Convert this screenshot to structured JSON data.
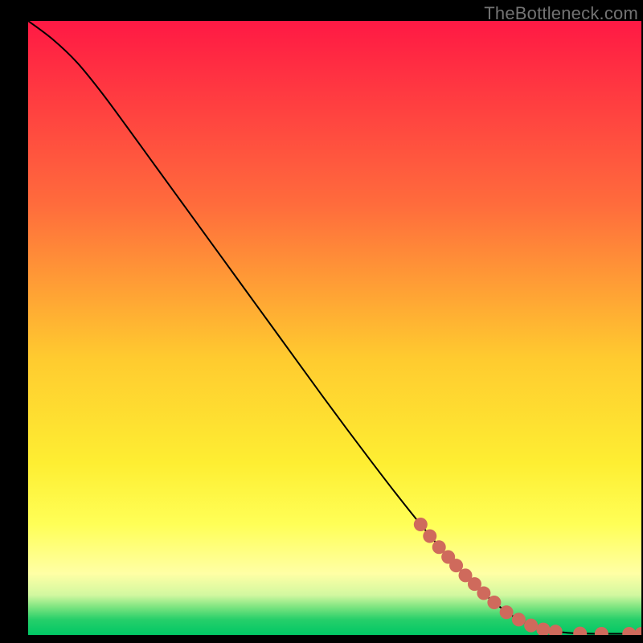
{
  "attribution": "TheBottleneck.com",
  "colors": {
    "border": "#000000",
    "curve": "#000000",
    "marker": "#cf6a5c",
    "gradient_stops": [
      {
        "offset": 0.0,
        "color": "#ff1944"
      },
      {
        "offset": 0.3,
        "color": "#ff6c3c"
      },
      {
        "offset": 0.55,
        "color": "#ffcb2f"
      },
      {
        "offset": 0.72,
        "color": "#feee32"
      },
      {
        "offset": 0.82,
        "color": "#ffff57"
      },
      {
        "offset": 0.9,
        "color": "#ffffa5"
      },
      {
        "offset": 0.935,
        "color": "#d2f8a0"
      },
      {
        "offset": 0.955,
        "color": "#7be480"
      },
      {
        "offset": 0.975,
        "color": "#26cf6a"
      },
      {
        "offset": 1.0,
        "color": "#00c765"
      }
    ]
  },
  "chart_data": {
    "type": "line",
    "title": "",
    "xlabel": "",
    "ylabel": "",
    "xlim": [
      0,
      100
    ],
    "ylim": [
      0,
      100
    ],
    "legend": false,
    "grid": false,
    "series": [
      {
        "name": "curve",
        "x": [
          0,
          4,
          8,
          12,
          16,
          20,
          24,
          28,
          32,
          36,
          40,
          44,
          48,
          52,
          56,
          60,
          64,
          68,
          72,
          76,
          80,
          84,
          86,
          88,
          90,
          91.5,
          93,
          95,
          97,
          100
        ],
        "y": [
          100,
          97.0,
          93.2,
          88.3,
          82.9,
          77.4,
          71.9,
          66.4,
          60.9,
          55.4,
          49.9,
          44.4,
          38.9,
          33.5,
          28.2,
          23.0,
          18.0,
          13.3,
          9.0,
          5.3,
          2.5,
          0.9,
          0.55,
          0.35,
          0.25,
          0.22,
          0.2,
          0.2,
          0.2,
          0.2
        ]
      }
    ],
    "markers": [
      {
        "x": 64.0,
        "y": 18.0
      },
      {
        "x": 65.5,
        "y": 16.1
      },
      {
        "x": 67.0,
        "y": 14.3
      },
      {
        "x": 68.5,
        "y": 12.7
      },
      {
        "x": 69.8,
        "y": 11.3
      },
      {
        "x": 71.3,
        "y": 9.7
      },
      {
        "x": 72.8,
        "y": 8.3
      },
      {
        "x": 74.3,
        "y": 6.8
      },
      {
        "x": 76.0,
        "y": 5.3
      },
      {
        "x": 78.0,
        "y": 3.7
      },
      {
        "x": 80.0,
        "y": 2.5
      },
      {
        "x": 82.0,
        "y": 1.55
      },
      {
        "x": 84.0,
        "y": 0.9
      },
      {
        "x": 86.0,
        "y": 0.55
      },
      {
        "x": 90.0,
        "y": 0.25
      },
      {
        "x": 93.5,
        "y": 0.2
      },
      {
        "x": 98.0,
        "y": 0.2
      },
      {
        "x": 100.0,
        "y": 0.2
      }
    ]
  }
}
